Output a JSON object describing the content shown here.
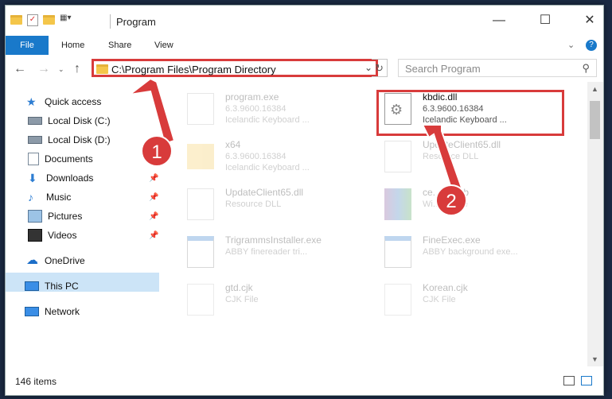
{
  "window": {
    "title": "Program"
  },
  "ribbon": {
    "tabs": [
      "File",
      "Home",
      "Share",
      "View"
    ]
  },
  "address": {
    "path": "C:\\Program Files\\Program Directory"
  },
  "search": {
    "placeholder": "Search Program"
  },
  "sidebar": {
    "items": [
      {
        "label": "Quick access",
        "icon": "star-icon"
      },
      {
        "label": "Local Disk (C:)",
        "icon": "drive-icon"
      },
      {
        "label": "Local Disk (D:)",
        "icon": "drive-icon"
      },
      {
        "label": "Documents",
        "icon": "documents-icon",
        "pinned": true
      },
      {
        "label": "Downloads",
        "icon": "download-icon",
        "pinned": true
      },
      {
        "label": "Music",
        "icon": "music-icon",
        "pinned": true
      },
      {
        "label": "Pictures",
        "icon": "pictures-icon",
        "pinned": true
      },
      {
        "label": "Videos",
        "icon": "videos-icon",
        "pinned": true
      },
      {
        "label": "OneDrive",
        "icon": "cloud-icon"
      },
      {
        "label": "This PC",
        "icon": "monitor-icon",
        "selected": true
      },
      {
        "label": "Network",
        "icon": "network-icon"
      }
    ]
  },
  "files": [
    {
      "name": "program.exe",
      "line2": "6.3.9600.16384",
      "line3": "Icelandic Keyboard ..."
    },
    {
      "name": "kbdic.dll",
      "line2": "6.3.9600.16384",
      "line3": "Icelandic Keyboard ..."
    },
    {
      "name": "x64",
      "line2": "6.3.9600.16384",
      "line3": "Icelandic Keyboard ..."
    },
    {
      "name": "UpdateClient65.dll",
      "line2": "Resource DLL",
      "line3": ""
    },
    {
      "name": "UpdateClient65.dll",
      "line2": "Resource DLL",
      "line3": ""
    },
    {
      "name": "ce...es.cab",
      "line2": "Wi... ...ctive",
      "line3": ""
    },
    {
      "name": "TrigrammsInstaller.exe",
      "line2": "ABBY finereader tri...",
      "line3": ""
    },
    {
      "name": "FineExec.exe",
      "line2": "ABBY background exe...",
      "line3": ""
    },
    {
      "name": "gtd.cjk",
      "line2": "CJK File",
      "line3": ""
    },
    {
      "name": "Korean.cjk",
      "line2": "CJK File",
      "line3": ""
    }
  ],
  "status": {
    "count": "146 items"
  },
  "markers": {
    "one": "1",
    "two": "2"
  },
  "colors": {
    "accent": "#1979ca",
    "highlight": "#d83b3b",
    "selected_bg": "#cce4f7"
  }
}
